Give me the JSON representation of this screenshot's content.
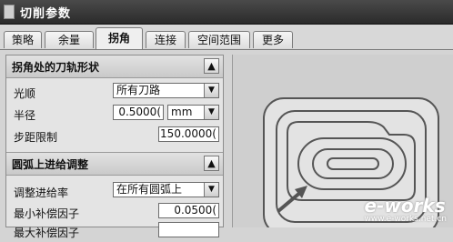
{
  "window": {
    "title": "切削参数"
  },
  "tabs": [
    {
      "label": "策略"
    },
    {
      "label": "余量"
    },
    {
      "label": "拐角"
    },
    {
      "label": "连接"
    },
    {
      "label": "空间范围"
    },
    {
      "label": "更多"
    }
  ],
  "active_tab": "拐角",
  "section1": {
    "title": "拐角处的刀轨形状",
    "smooth": {
      "label": "光顺",
      "value": "所有刀路"
    },
    "radius": {
      "label": "半径",
      "value": "0.5000(",
      "unit": "mm"
    },
    "step_limit": {
      "label": "步距限制",
      "value": "150.0000("
    }
  },
  "section2": {
    "title": "圆弧上进给调整",
    "adjust_feed": {
      "label": "调整进给率",
      "value": "在所有圆弧上"
    },
    "min_comp": {
      "label": "最小补偿因子",
      "value": "0.0500("
    },
    "max_comp": {
      "label": "最大补偿因子"
    }
  },
  "watermark": {
    "text": "e-works",
    "sub": "www.e-works.net.cn"
  },
  "icons": {
    "system": "window-icon",
    "collapse": "chevron-up-icon",
    "dropdown": "chevron-down-icon"
  }
}
